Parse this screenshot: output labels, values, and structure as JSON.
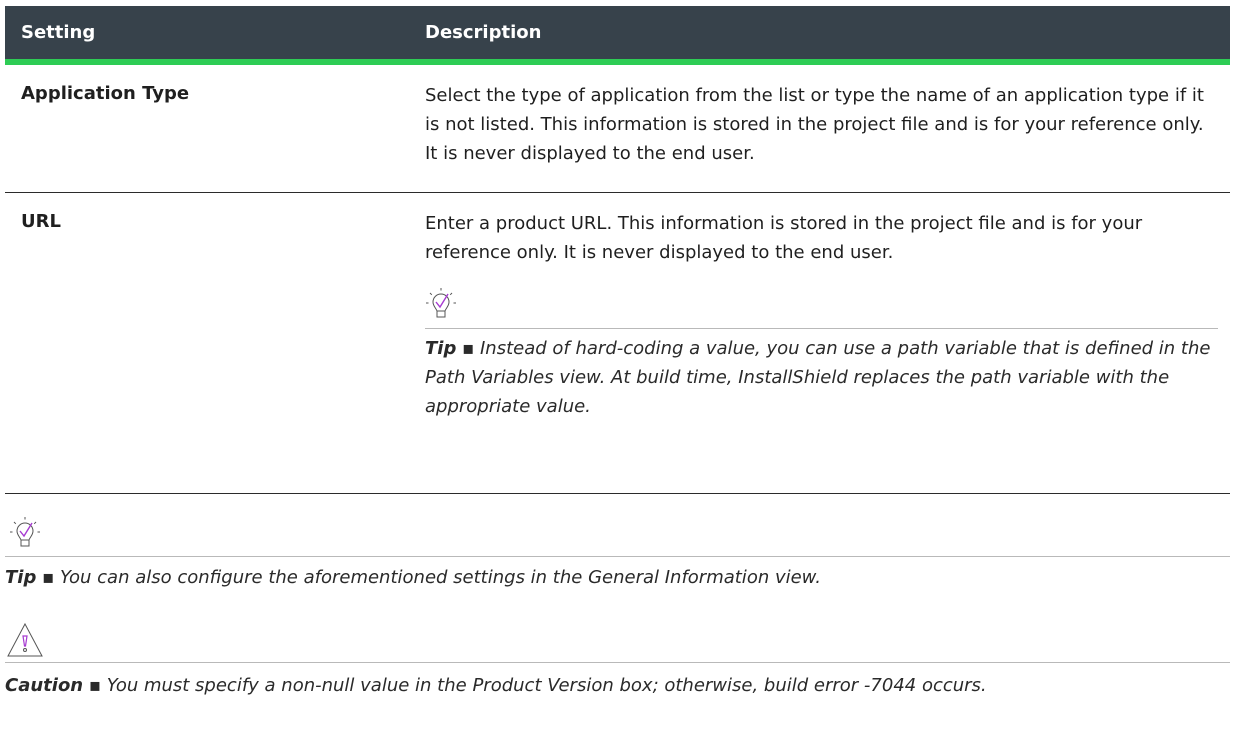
{
  "table": {
    "headers": [
      "Setting",
      "Description"
    ],
    "rows": [
      {
        "setting": "Application Type",
        "description": "Select the type of application from the list or type the name of an application type if it is not listed. This information is stored in the project file and is for your reference only. It is never displayed to the end user."
      },
      {
        "setting": "URL",
        "description": "Enter a product URL. This information is stored in the project file and is for your reference only. It is never displayed to the end user.",
        "tip_label": "Tip",
        "tip_separator": " ▪ ",
        "tip_text": "Instead of hard-coding a value, you can use a path variable that is defined in the Path Variables view. At build time, InstallShield replaces the path variable with the appropriate value."
      }
    ]
  },
  "tip": {
    "label": "Tip",
    "separator": " ▪ ",
    "text": "You can also configure the aforementioned settings in the General Information view."
  },
  "caution": {
    "label": "Caution",
    "separator": " ▪ ",
    "text": "You must specify a non-null value in the Product Version box; otherwise, build error -7044 occurs."
  },
  "icons": {
    "tip": "lightbulb-check-icon",
    "caution": "warning-triangle-icon"
  },
  "colors": {
    "header_bg": "#37424b",
    "header_accent": "#2ecc55",
    "icon_accent": "#a63ad1"
  }
}
